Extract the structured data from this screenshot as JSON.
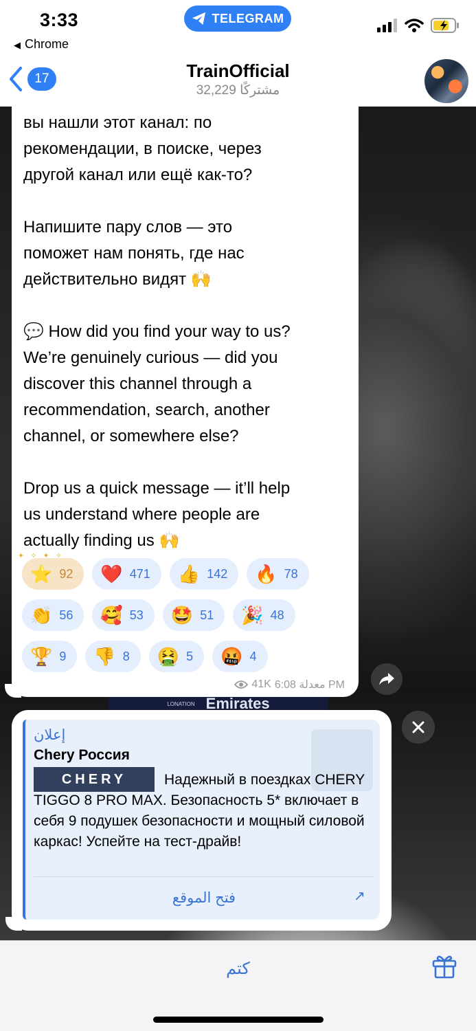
{
  "status_bar": {
    "time": "3:33",
    "back_app": "Chrome",
    "pill_label": "TELEGRAM"
  },
  "nav": {
    "back_count": "17",
    "title": "TrainOfficial",
    "subtitle": "32,229 مشتركًا"
  },
  "message": {
    "text": "вы нашли этот канал: по\nрекомендации, в поиске, через\nдругой канал или ещё как-то?\n\nНапишите пару слов — это\nпоможет нам понять, где нас\nдействительно видят 🙌\n\n💬 How did you find your way to us?\nWe’re genuinely curious — did you\ndiscover this channel through a\nrecommendation, search, another\nchannel, or somewhere else?\n\nDrop us a quick message — it’ll help\nus understand where people are\nactually finding us 🙌",
    "reactions": [
      {
        "emoji": "⭐",
        "count": "92"
      },
      {
        "emoji": "❤️",
        "count": "471"
      },
      {
        "emoji": "👍",
        "count": "142"
      },
      {
        "emoji": "🔥",
        "count": "78"
      },
      {
        "emoji": "👏",
        "count": "56"
      },
      {
        "emoji": "🥰",
        "count": "53"
      },
      {
        "emoji": "🤩",
        "count": "51"
      },
      {
        "emoji": "🎉",
        "count": "48"
      },
      {
        "emoji": "🏆",
        "count": "9"
      },
      {
        "emoji": "👎",
        "count": "8"
      },
      {
        "emoji": "🤮",
        "count": "5"
      },
      {
        "emoji": "🤬",
        "count": "4"
      }
    ],
    "views": "41K",
    "edited_time": "6:08 معدلة PM"
  },
  "background": {
    "jersey_text": "Emirates",
    "jersey_small": "LONATION"
  },
  "ad": {
    "label": "إعلان",
    "title": "Chery Россия",
    "logo_text": "CHERY",
    "body": "Надежный в поездках CHERY TIGGO 8 PRO MAX. Безопасность 5* включает в себя 9 подушек безопасности и мощный силовой каркас! Успейте на тест-драйв!",
    "link": "فتح الموقع"
  },
  "bottom": {
    "mute_label": "كتم"
  },
  "colors": {
    "accent": "#2f7ff5",
    "link": "#3a73d6",
    "reaction_bg": "#e4eefc",
    "starred_bg": "#f7e3c6"
  },
  "icons": [
    "telegram-icon",
    "signal-icon",
    "wifi-icon",
    "battery-icon",
    "back-chevron-icon",
    "eye-icon",
    "share-icon",
    "close-icon",
    "external-arrow-icon",
    "gift-icon"
  ]
}
